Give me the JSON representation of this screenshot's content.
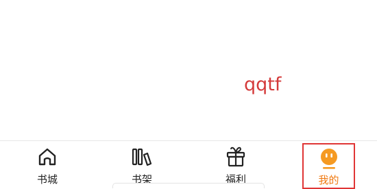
{
  "annotation": {
    "text": "qqtf"
  },
  "tabbar": {
    "tabs": [
      {
        "label": "书城",
        "icon": "home-icon"
      },
      {
        "label": "书架",
        "icon": "bookshelf-icon"
      },
      {
        "label": "福利",
        "icon": "gift-icon"
      },
      {
        "label": "我的",
        "icon": "profile-face-icon",
        "active": true
      }
    ]
  },
  "colors": {
    "active_tab": "#f07a12",
    "annotation": "#d43a3a",
    "highlight_box": "#e03535"
  }
}
